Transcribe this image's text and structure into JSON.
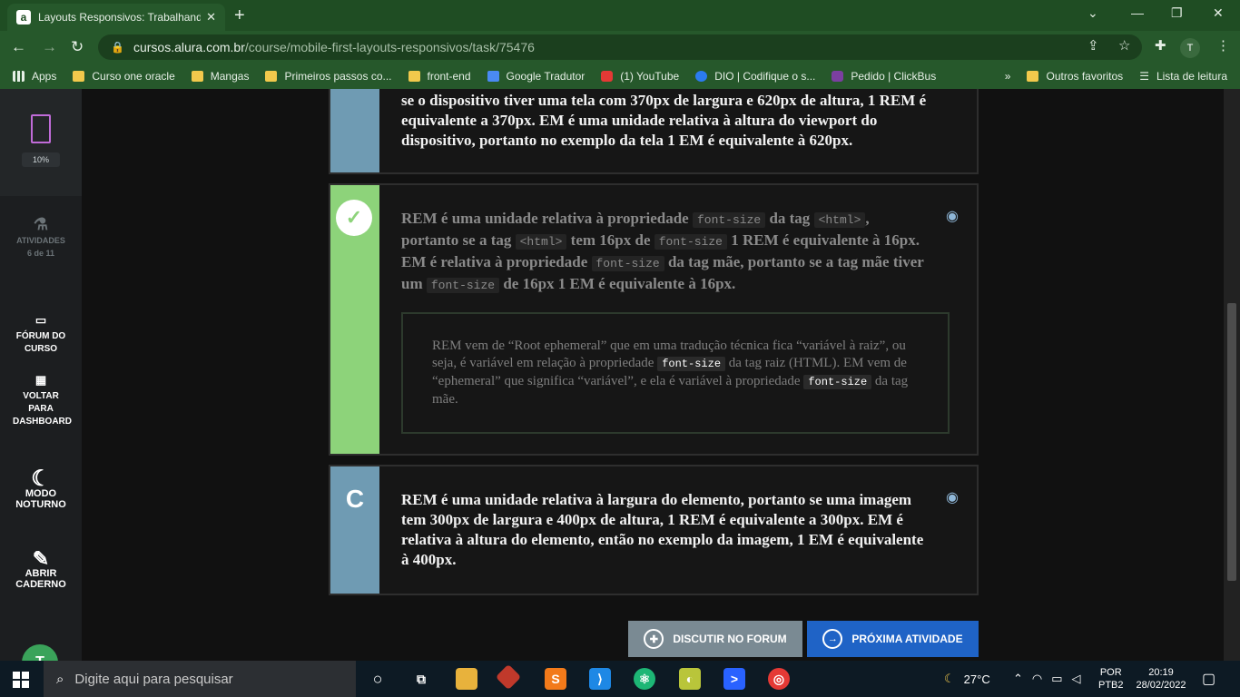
{
  "browser": {
    "tab_title": "Layouts Responsivos: Trabalhand",
    "tab_favicon": "a",
    "url_domain": "cursos.alura.com.br",
    "url_path": "/course/mobile-first-layouts-responsivos/task/75476",
    "profile_initial": "T",
    "bookmarks": [
      {
        "label": "Apps",
        "icon": "apps-icon"
      },
      {
        "label": "Curso one oracle",
        "icon": "folder-icon"
      },
      {
        "label": "Mangas",
        "icon": "folder-icon"
      },
      {
        "label": "Primeiros passos co...",
        "icon": "folder-icon"
      },
      {
        "label": "front-end",
        "icon": "folder-icon"
      },
      {
        "label": "Google Tradutor",
        "icon": "google-translate-icon"
      },
      {
        "label": "(1) YouTube",
        "icon": "youtube-icon"
      },
      {
        "label": "DIO | Codifique o s...",
        "icon": "dio-icon"
      },
      {
        "label": "Pedido | ClickBus",
        "icon": "clickbus-icon"
      }
    ],
    "bookmarks_more": "»",
    "other_bookmarks": "Outros favoritos",
    "reading_list": "Lista de leitura"
  },
  "sidebar": {
    "progress": "10%",
    "activities_label": "ATIVIDADES",
    "activities_count": "6 de 11",
    "forum_label": "FÓRUM DO CURSO",
    "dashboard_label": "VOLTAR PARA DASHBOARD",
    "night_mode_label": "MODO NOTURNO",
    "notebook_label": "ABRIR CADERNO",
    "user_initial": "T"
  },
  "options": {
    "b_partial": "se o dispositivo tiver uma tela com 370px de largura e 620px de altura, 1 REM é equivalente a 370px. EM é uma unidade relativa à altura do viewport do dispositivo, portanto no exemplo da tela 1 EM é equivalente à 620px.",
    "correct": {
      "t1": "REM é uma unidade relativa à propriedade",
      "c1": "font-size",
      "t2": "da tag",
      "c2": "<html>",
      "t3": ", portanto se a tag",
      "c3": "<html>",
      "t4": "tem 16px de",
      "c4": "font-size",
      "t5": "1 REM é equivalente à 16px. EM é relativa à propriedade",
      "c5": "font-size",
      "t6": "da tag mãe, portanto se a tag mãe tiver um",
      "c6": "font-size",
      "t7": "de 16px 1 EM é equivalente à 16px."
    },
    "explanation": {
      "t1": "REM vem de “Root ephemeral” que em uma tradução técnica fica “variável à raiz”, ou seja, é variável em relação à propriedade",
      "c1": "font-size",
      "t2": "da tag raiz (HTML). EM vem de “ephemeral” que significa “variável”, e ela é variável à propriedade",
      "c2": "font-size",
      "t3": "da tag mãe."
    },
    "c_letter": "C",
    "c_text": "REM é uma unidade relativa à largura do elemento, portanto se uma imagem tem 300px de largura e 400px de altura, 1 REM é equivalente a 300px. EM é relativa à altura do elemento, então no exemplo da imagem, 1 EM é equivalente à 400px."
  },
  "actions": {
    "forum_button": "DISCUTIR NO FORUM",
    "next_button": "PRÓXIMA ATIVIDADE"
  },
  "taskbar": {
    "search_placeholder": "Digite aqui para pesquisar",
    "temperature": "27°C",
    "lang1": "POR",
    "lang2": "PTB2",
    "time": "20:19",
    "date": "28/02/2022"
  },
  "colors": {
    "answer_b_bar": "#6f9bb3",
    "correct_bar": "#8dd37a",
    "answer_c_bar": "#6f9bb3",
    "forum_button_bg": "#7a8a93",
    "next_button_bg": "#1f63c6",
    "chrome_green": "#26582b"
  }
}
